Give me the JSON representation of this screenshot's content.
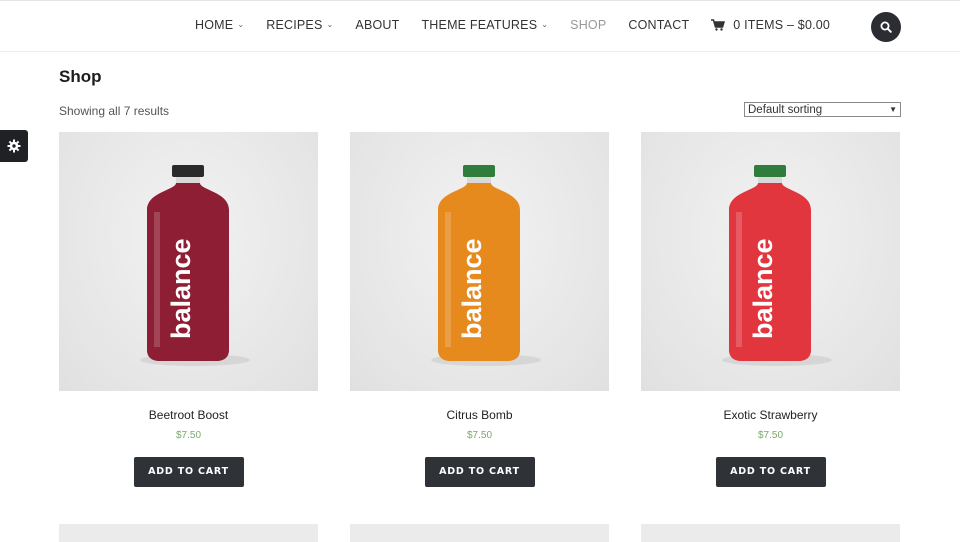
{
  "header": {
    "nav": [
      {
        "label": "HOME",
        "has_dropdown": true,
        "active": false
      },
      {
        "label": "RECIPES",
        "has_dropdown": true,
        "active": false
      },
      {
        "label": "ABOUT",
        "has_dropdown": false,
        "active": false
      },
      {
        "label": "THEME FEATURES",
        "has_dropdown": true,
        "active": false
      },
      {
        "label": "SHOP",
        "has_dropdown": false,
        "active": true
      },
      {
        "label": "CONTACT",
        "has_dropdown": false,
        "active": false
      }
    ],
    "cart_label": "0 ITEMS – $0.00",
    "cart_icon": "shopping-cart-icon",
    "search_icon": "search-icon"
  },
  "side_panel": {
    "icon": "gear-icon"
  },
  "main": {
    "title": "Shop",
    "result_count": "Showing all 7 results",
    "sort_selected": "Default sorting"
  },
  "products": [
    {
      "name": "Beetroot Boost",
      "price": "$7.50",
      "button": "ADD TO CART",
      "bottle_color": "#8e1e33",
      "cap_color": "#2a2a2a",
      "brand": "balance"
    },
    {
      "name": "Citrus Bomb",
      "price": "$7.50",
      "button": "ADD TO CART",
      "bottle_color": "#e68a1e",
      "cap_color": "#2e7d3a",
      "brand": "balance"
    },
    {
      "name": "Exotic Strawberry",
      "price": "$7.50",
      "button": "ADD TO CART",
      "bottle_color": "#e2363f",
      "cap_color": "#2e7d3a",
      "brand": "balance"
    }
  ],
  "colors": {
    "dark_button": "#2f3237",
    "price_green": "#7aa96b",
    "active_nav": "#999999"
  }
}
